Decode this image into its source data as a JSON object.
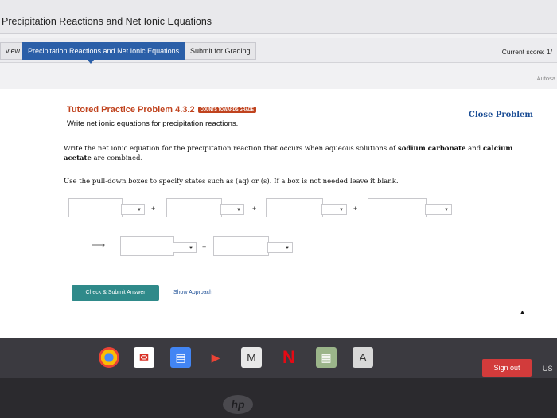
{
  "window": {
    "title": "Precipitation Reactions and Net Ionic Equations"
  },
  "tabs": [
    {
      "label": "view"
    },
    {
      "label": "Precipitation Reactions and Net Ionic Equations"
    },
    {
      "label": "Submit for Grading"
    }
  ],
  "header": {
    "score_label": "Current score: 1/",
    "autosave": "Autosa"
  },
  "problem": {
    "title": "Tutored Practice Problem 4.3.2",
    "badge": "COUNTS TOWARDS GRADE",
    "subtitle": "Write net ionic equations for precipitation reactions.",
    "close_label": "Close Problem",
    "question_part1": "Write the net ionic equation for the precipitation reaction that occurs when aqueous solutions of ",
    "question_bold1": "sodium carbonate",
    "question_part2": " and ",
    "question_bold2": "calcium acetate",
    "question_part3": " are combined.",
    "instruction": "Use the pull-down boxes to specify states such as (aq) or (s). If a box is not needed leave it blank."
  },
  "equation": {
    "plus": "+",
    "arrow": "⟶",
    "dropdown_caret": "▼"
  },
  "buttons": {
    "check_submit": "Check & Submit Answer",
    "show_approach": "Show Approach"
  },
  "taskbar": {
    "sign_out": "Sign out",
    "locale": "US",
    "m_label": "M",
    "n_label": "N",
    "a_label": "A"
  },
  "colors": {
    "accent": "#2b5fa8",
    "title_red": "#c0431e",
    "check_button": "#2f8a8a",
    "signout": "#d23b3b"
  }
}
